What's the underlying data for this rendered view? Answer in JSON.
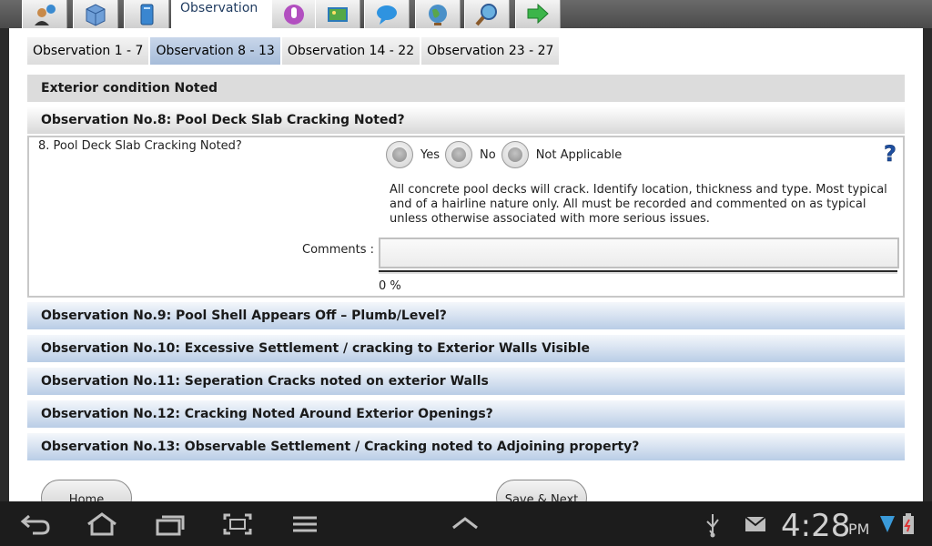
{
  "toolbar": {
    "active_tab": "Observation",
    "icons": [
      "contact-icon",
      "package-icon",
      "document-icon",
      "microphone-icon",
      "photo-icon",
      "chat-icon",
      "globe-icon",
      "map-search-icon",
      "exit-arrow-icon"
    ]
  },
  "subtabs": [
    {
      "label": "Observation 1 - 7",
      "active": false
    },
    {
      "label": "Observation 8 - 13",
      "active": true
    },
    {
      "label": "Observation 14 - 22",
      "active": false
    },
    {
      "label": "Observation 23 - 27",
      "active": false
    }
  ],
  "section_header": "Exterior condition Noted",
  "current": {
    "title": "Observation No.8: Pool Deck Slab Cracking Noted?",
    "question": "8. Pool Deck Slab Cracking Noted?",
    "options": [
      "Yes",
      "No",
      "Not Applicable"
    ],
    "description": "All concrete pool decks will crack. Identify location, thickness and type. Most typical and of a hairline nature only. All must be recorded and commented on as typical unless otherwise associated with more serious issues.",
    "comments_label": "Comments :",
    "comments_value": "",
    "progress_percent": 0,
    "progress_text": "0 %"
  },
  "observations": [
    "Observation No.9: Pool Shell Appears Off – Plumb/Level?",
    "Observation No.10: Excessive Settlement / cracking to Exterior Walls Visible",
    "Observation No.11: Seperation Cracks noted on exterior Walls",
    "Observation No.12: Cracking Noted Around Exterior Openings?",
    "Observation No.13: Observable Settlement / Cracking noted to Adjoining property?"
  ],
  "buttons": {
    "home": "Home",
    "save_next": "Save & Next"
  },
  "status": {
    "time": "4:28",
    "ampm": "PM"
  },
  "colors": {
    "accent": "#1e3a5f",
    "blue_bar": "#b9cde6",
    "progress_fill": "#d4a017"
  }
}
